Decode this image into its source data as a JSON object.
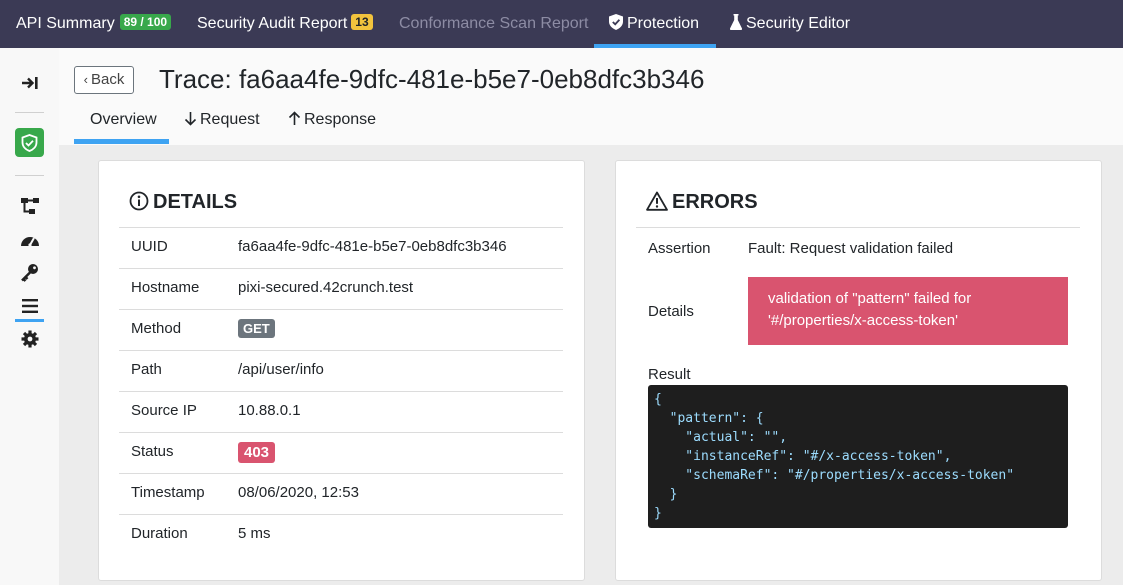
{
  "topnav": {
    "api_summary": {
      "label": "API Summary",
      "score": "89 / 100"
    },
    "security_audit": {
      "label": "Security Audit Report",
      "count": "13"
    },
    "conformance": {
      "label": "Conformance Scan Report"
    },
    "protection": {
      "label": "Protection"
    },
    "security_editor": {
      "label": "Security Editor"
    }
  },
  "header": {
    "back_label": "Back",
    "title": "Trace: fa6aa4fe-9dfc-481e-b5e7-0eb8dfc3b346",
    "tabs": [
      "Overview",
      "Request",
      "Response"
    ],
    "active_tab": "Overview"
  },
  "details": {
    "title": "DETAILS",
    "rows": [
      {
        "key": "UUID",
        "value": "fa6aa4fe-9dfc-481e-b5e7-0eb8dfc3b346"
      },
      {
        "key": "Hostname",
        "value": "pixi-secured.42crunch.test"
      },
      {
        "key": "Method",
        "value": "GET"
      },
      {
        "key": "Path",
        "value": "/api/user/info"
      },
      {
        "key": "Source IP",
        "value": "10.88.0.1"
      },
      {
        "key": "Status",
        "value": "403"
      },
      {
        "key": "Timestamp",
        "value": "08/06/2020, 12:53"
      },
      {
        "key": "Duration",
        "value": "5 ms"
      }
    ]
  },
  "errors": {
    "title": "ERRORS",
    "assertion_label": "Assertion",
    "assertion_value": "Fault: Request validation failed",
    "details_label": "Details",
    "details_message": "validation of \"pattern\" failed for '#/properties/x-access-token'",
    "result_label": "Result",
    "result_code": "{\n  \"pattern\": {\n    \"actual\": \"\",\n    \"instanceRef\": \"#/x-access-token\",\n    \"schemaRef\": \"#/properties/x-access-token\"\n  }\n}"
  },
  "colors": {
    "topbar": "#3b3a55",
    "accent": "#3ea3f2",
    "success": "#38a84b",
    "danger": "#d9546f",
    "warning": "#f2c33d"
  },
  "icons": {
    "sidebar": [
      "collapse-icon",
      "shield-check-icon",
      "hierarchy-icon",
      "dashboard-icon",
      "key-icon",
      "list-icon",
      "gear-icon"
    ],
    "header": [
      "chevron-left-icon",
      "arrow-down-icon",
      "arrow-up-icon"
    ],
    "cards": [
      "info-circle-icon",
      "warning-triangle-icon"
    ]
  }
}
